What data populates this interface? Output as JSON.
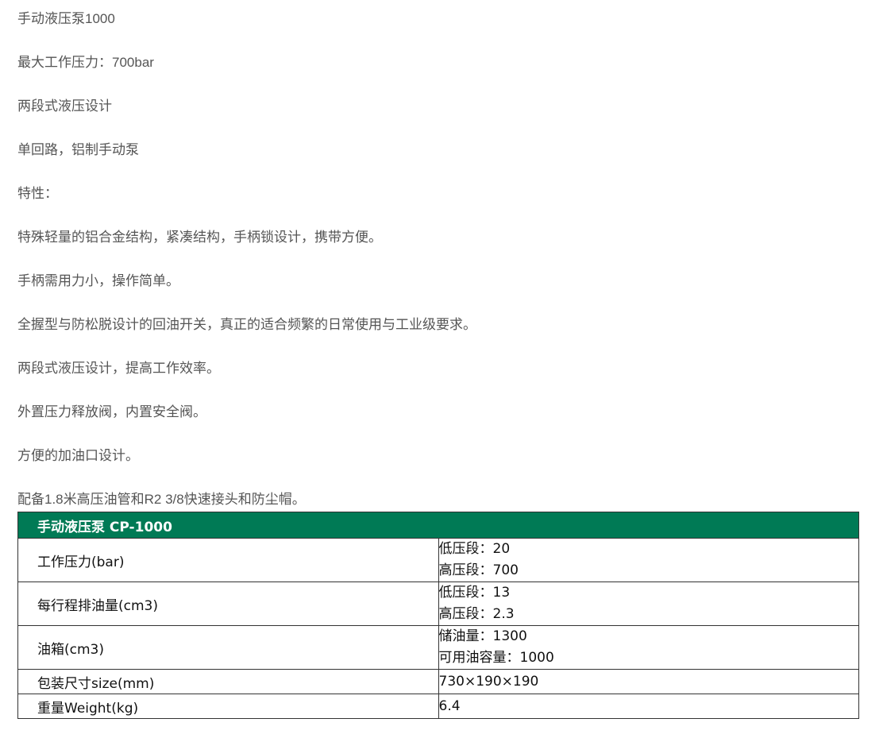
{
  "paragraphs": [
    "手动液压泵1000",
    "最大工作压力：700bar",
    "两段式液压设计",
    "单回路，铝制手动泵",
    "特性：",
    "特殊轻量的铝合金结构，紧凑结构，手柄锁设计，携带方便。",
    "手柄需用力小，操作简单。",
    "全握型与防松脱设计的回油开关，真正的适合频繁的日常使用与工业级要求。",
    "两段式液压设计，提高工作效率。",
    "外置压力释放阀，内置安全阀。",
    "方便的加油口设计。",
    "配备1.8米高压油管和R2 3/8快速接头和防尘帽。"
  ],
  "table": {
    "header": "手动液压泵 CP-1000",
    "accent_color": "#007a55",
    "rows": [
      {
        "label": "工作压力(bar)",
        "values": [
          "低压段：20",
          "高压段：700"
        ]
      },
      {
        "label": "每行程排油量(cm3)",
        "values": [
          "低压段：13",
          "高压段：2.3"
        ]
      },
      {
        "label": "油箱(cm3)",
        "values": [
          "储油量：1300",
          "可用油容量：1000"
        ]
      },
      {
        "label": "包装尺寸size(mm)",
        "values": [
          "730×190×190"
        ]
      },
      {
        "label": "重量Weight(kg)",
        "values": [
          "6.4"
        ]
      }
    ]
  }
}
